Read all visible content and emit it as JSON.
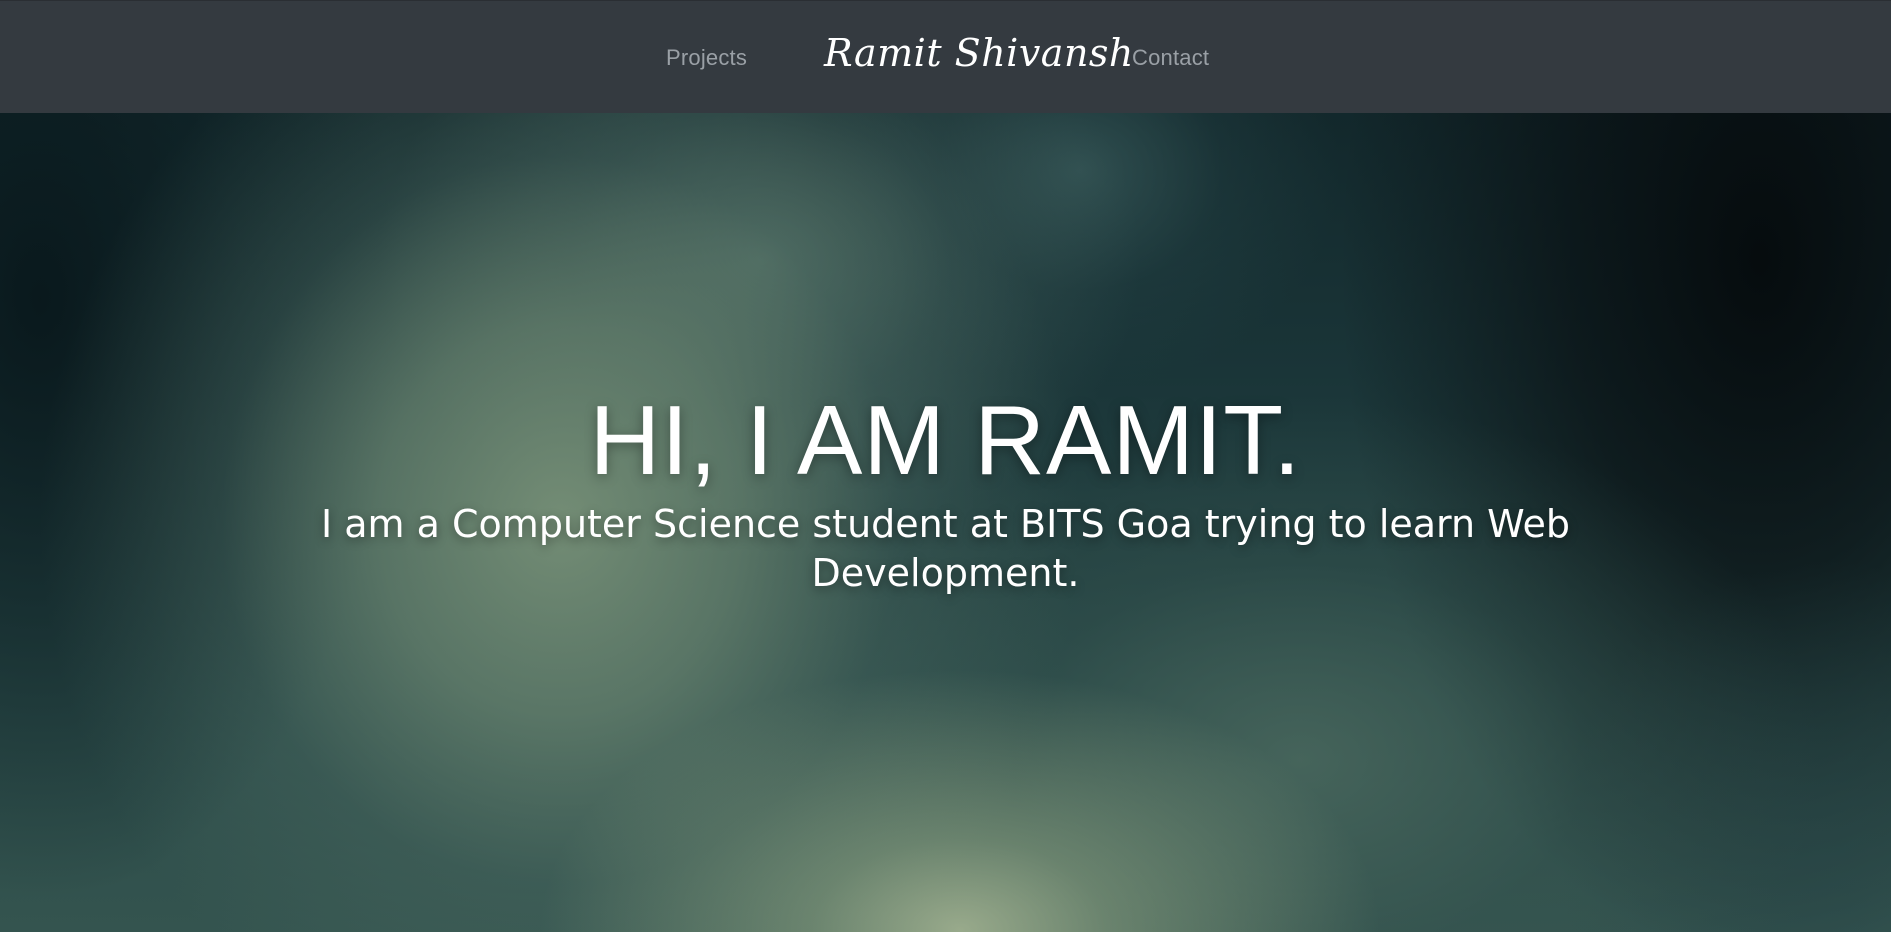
{
  "navbar": {
    "links": [
      {
        "label": "Projects"
      },
      {
        "label": "Contact"
      }
    ],
    "brand": "Ramit Shivansh"
  },
  "hero": {
    "title": "HI, I AM RAMIT.",
    "subtitle": "I am a Computer Science student at BITS Goa trying to learn Web Development."
  },
  "colors": {
    "navbar_bg": "#343a40",
    "nav_link": "#9aa0a6",
    "brand": "#ffffff",
    "hero_text": "#ffffff"
  }
}
